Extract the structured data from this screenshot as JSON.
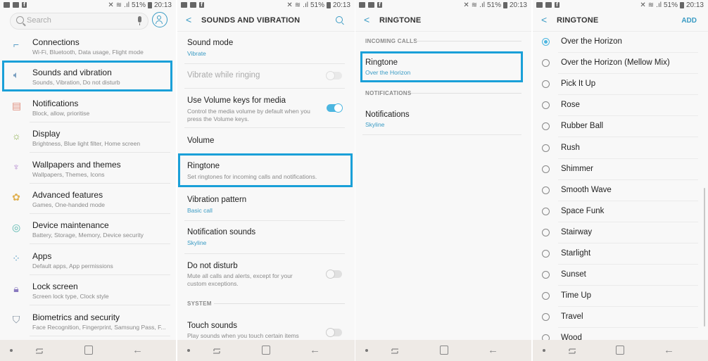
{
  "status_bar": {
    "battery": "51%",
    "time": "20:13"
  },
  "panel1": {
    "search_placeholder": "Search",
    "items": [
      {
        "title": "Connections",
        "subtitle": "Wi-Fi, Bluetooth, Data usage, Flight mode",
        "icon": "connections-icon",
        "glyph": "⌐",
        "color": "#5b9fc7"
      },
      {
        "title": "Sounds and vibration",
        "subtitle": "Sounds, Vibration, Do not disturb",
        "icon": "speaker-icon",
        "glyph": "🔈︎",
        "color": "#7a9fc0"
      },
      {
        "title": "Notifications",
        "subtitle": "Block, allow, prioritise",
        "icon": "notifications-icon",
        "glyph": "▤",
        "color": "#e09080"
      },
      {
        "title": "Display",
        "subtitle": "Brightness, Blue light filter, Home screen",
        "icon": "display-icon",
        "glyph": "☼",
        "color": "#8aac4a"
      },
      {
        "title": "Wallpapers and themes",
        "subtitle": "Wallpapers, Themes, Icons",
        "icon": "brush-icon",
        "glyph": "♆",
        "color": "#b48ad0"
      },
      {
        "title": "Advanced features",
        "subtitle": "Games, One-handed mode",
        "icon": "gear-plus-icon",
        "glyph": "✿",
        "color": "#e0b050"
      },
      {
        "title": "Device maintenance",
        "subtitle": "Battery, Storage, Memory, Device security",
        "icon": "maintenance-icon",
        "glyph": "◎",
        "color": "#5ab8b0"
      },
      {
        "title": "Apps",
        "subtitle": "Default apps, App permissions",
        "icon": "apps-icon",
        "glyph": "⁘",
        "color": "#5b9fc7"
      },
      {
        "title": "Lock screen",
        "subtitle": "Screen lock type, Clock style",
        "icon": "lock-icon",
        "glyph": "🔒︎",
        "color": "#8a7ac0"
      },
      {
        "title": "Biometrics and security",
        "subtitle": "Face Recognition, Fingerprint, Samsung Pass, F...",
        "icon": "shield-icon",
        "glyph": "⛉",
        "color": "#7a8a9a"
      }
    ]
  },
  "panel2": {
    "title": "SOUNDS AND VIBRATION",
    "sound_mode": {
      "title": "Sound mode",
      "value": "Vibrate"
    },
    "vibrate_while_ringing": {
      "title": "Vibrate while ringing",
      "enabled": false,
      "on": false
    },
    "volume_keys": {
      "title": "Use Volume keys for media",
      "subtitle": "Control the media volume by default when you press the Volume keys.",
      "on": true
    },
    "volume": {
      "title": "Volume"
    },
    "ringtone": {
      "title": "Ringtone",
      "subtitle": "Set ringtones for incoming calls and notifications."
    },
    "vibration_pattern": {
      "title": "Vibration pattern",
      "value": "Basic call"
    },
    "notification_sounds": {
      "title": "Notification sounds",
      "value": "Skyline"
    },
    "do_not_disturb": {
      "title": "Do not disturb",
      "subtitle": "Mute all calls and alerts, except for your custom exceptions.",
      "on": false
    },
    "section_system": "SYSTEM",
    "touch_sounds": {
      "title": "Touch sounds",
      "subtitle": "Play sounds when you touch certain items",
      "on": false
    }
  },
  "panel3": {
    "title": "RINGTONE",
    "section_incoming": "INCOMING CALLS",
    "ringtone": {
      "title": "Ringtone",
      "value": "Over the Horizon"
    },
    "section_notifications": "NOTIFICATIONS",
    "notifications": {
      "title": "Notifications",
      "value": "Skyline"
    }
  },
  "panel4": {
    "title": "RINGTONE",
    "add_label": "ADD",
    "selected": "Over the Horizon",
    "ringtones": [
      "Over the Horizon",
      "Over the Horizon (Mellow Mix)",
      "Pick It Up",
      "Rose",
      "Rubber Ball",
      "Rush",
      "Shimmer",
      "Smooth Wave",
      "Space Funk",
      "Stairway",
      "Starlight",
      "Sunset",
      "Time Up",
      "Travel",
      "Wood"
    ]
  },
  "colors": {
    "accent": "#3a9bc4",
    "highlight": "#1aa0d8",
    "toggle_on": "#4cb6e0"
  }
}
